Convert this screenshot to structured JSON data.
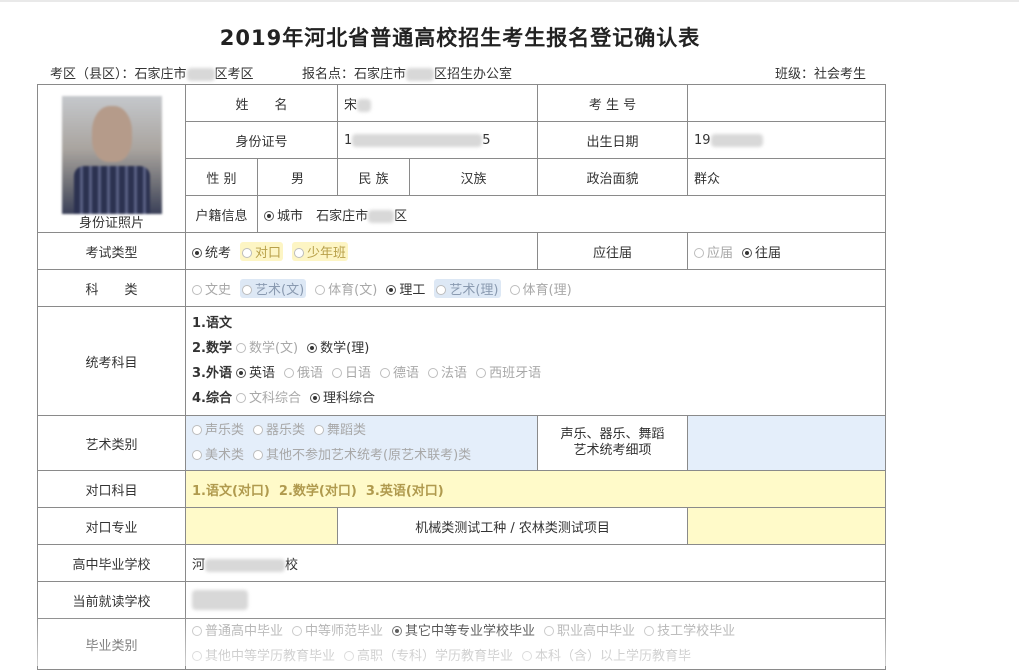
{
  "title": "2019年河北省普通高校招生考生报名登记确认表",
  "header": {
    "exam_area_prefix": "考区（县区）：石家庄市",
    "exam_area_suffix": "区考区",
    "reg_point_prefix": "报名点：石家庄市",
    "reg_point_suffix": "区招生办公室",
    "class": "班级：社会考生"
  },
  "photo_caption": "身份证照片",
  "labels": {
    "name": "姓　　名",
    "exam_no": "考 生 号",
    "id_no": "身份证号",
    "birth": "出生日期",
    "gender": "性 别",
    "ethnic": "民 族",
    "political": "政治面貌",
    "household": "户籍信息",
    "exam_type": "考试类型",
    "grad_status": "应往届",
    "subject_cat": "科　　类",
    "unified_subjects": "统考科目",
    "art_cat": "艺术类别",
    "art_detail": "声乐、器乐、舞蹈\n艺术统考细项",
    "duikou_subjects": "对口科目",
    "duikou_major": "对口专业",
    "duikou_test": "机械类测试工种 / 农林类测试项目",
    "hs_school": "高中毕业学校",
    "current_school": "当前就读学校",
    "grad_cat": "毕业类别"
  },
  "values": {
    "name_prefix": "宋",
    "id_prefix": "1",
    "id_suffix": "5",
    "birth_prefix": "19",
    "gender": "男",
    "ethnic": "汉族",
    "political": "群众",
    "household_option": "城市",
    "household_area_prefix": "石家庄市",
    "household_area_suffix": "区",
    "hs_school_prefix": "河",
    "hs_school_suffix": "校",
    "duikou_subjects": "1.语文(对口)  2.数学(对口)  3.英语(对口)"
  },
  "exam_type_options": [
    {
      "label": "统考",
      "checked": true,
      "style": "normal"
    },
    {
      "label": "对口",
      "checked": false,
      "style": "yellow"
    },
    {
      "label": "少年班",
      "checked": false,
      "style": "yellow"
    }
  ],
  "grad_status_options": [
    {
      "label": "应届",
      "checked": false,
      "style": "dis"
    },
    {
      "label": "往届",
      "checked": true,
      "style": "normal"
    }
  ],
  "subject_cat_options": [
    {
      "label": "文史",
      "checked": false,
      "style": "dis"
    },
    {
      "label": "艺术(文)",
      "checked": false,
      "style": "blue"
    },
    {
      "label": "体育(文)",
      "checked": false,
      "style": "dis"
    },
    {
      "label": "理工",
      "checked": true,
      "style": "normal"
    },
    {
      "label": "艺术(理)",
      "checked": false,
      "style": "blue"
    },
    {
      "label": "体育(理)",
      "checked": false,
      "style": "dis"
    }
  ],
  "unified_subjects": [
    {
      "key": "1.语文",
      "options": []
    },
    {
      "key": "2.数学",
      "options": [
        {
          "label": "数学(文)",
          "checked": false,
          "style": "dis"
        },
        {
          "label": "数学(理)",
          "checked": true,
          "style": "normal"
        }
      ]
    },
    {
      "key": "3.外语",
      "options": [
        {
          "label": "英语",
          "checked": true,
          "style": "normal"
        },
        {
          "label": "俄语",
          "checked": false,
          "style": "dis"
        },
        {
          "label": "日语",
          "checked": false,
          "style": "dis"
        },
        {
          "label": "德语",
          "checked": false,
          "style": "dis"
        },
        {
          "label": "法语",
          "checked": false,
          "style": "dis"
        },
        {
          "label": "西班牙语",
          "checked": false,
          "style": "dis"
        }
      ]
    },
    {
      "key": "4.综合",
      "options": [
        {
          "label": "文科综合",
          "checked": false,
          "style": "dis"
        },
        {
          "label": "理科综合",
          "checked": true,
          "style": "normal"
        }
      ]
    }
  ],
  "art_options_row1": [
    {
      "label": "声乐类",
      "checked": false,
      "style": "dis"
    },
    {
      "label": "器乐类",
      "checked": false,
      "style": "dis"
    },
    {
      "label": "舞蹈类",
      "checked": false,
      "style": "dis"
    }
  ],
  "art_options_row2": [
    {
      "label": "美术类",
      "checked": false,
      "style": "dis"
    },
    {
      "label": "其他不参加艺术统考(原艺术联考)类",
      "checked": false,
      "style": "dis"
    }
  ],
  "grad_cat_row1": [
    {
      "label": "普通高中毕业",
      "checked": false,
      "style": "dis"
    },
    {
      "label": "中等师范毕业",
      "checked": false,
      "style": "dis"
    },
    {
      "label": "其它中等专业学校毕业",
      "checked": true,
      "style": "normal"
    },
    {
      "label": "职业高中毕业",
      "checked": false,
      "style": "dis"
    },
    {
      "label": "技工学校毕业",
      "checked": false,
      "style": "dis"
    }
  ],
  "grad_cat_row2": [
    {
      "label": "其他中等学历教育毕业",
      "checked": false,
      "style": "dis"
    },
    {
      "label": "高职（专科）学历教育毕业",
      "checked": false,
      "style": "dis"
    },
    {
      "label": "本科（含）以上学历教育毕",
      "checked": false,
      "style": "dis"
    }
  ]
}
